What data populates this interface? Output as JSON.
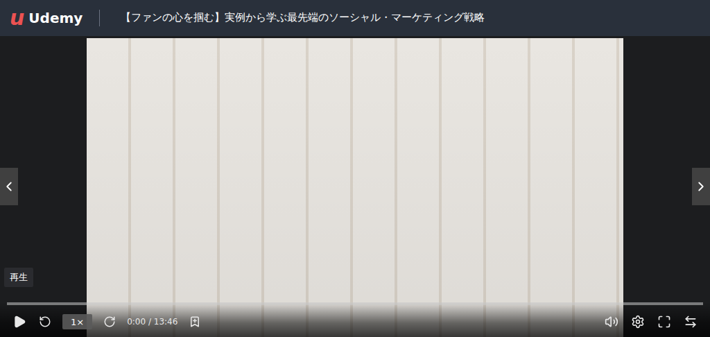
{
  "header": {
    "logo_mark": "u",
    "logo_text": "Udemy",
    "title": "【ファンの心を掴む】実例から学ぶ最先端のソーシャル・マーケティング戦略"
  },
  "player": {
    "playing": false,
    "tooltip": "再生",
    "progress": {
      "level": 0
    },
    "speed": "1×",
    "time": "0:00 / 13:46"
  }
}
